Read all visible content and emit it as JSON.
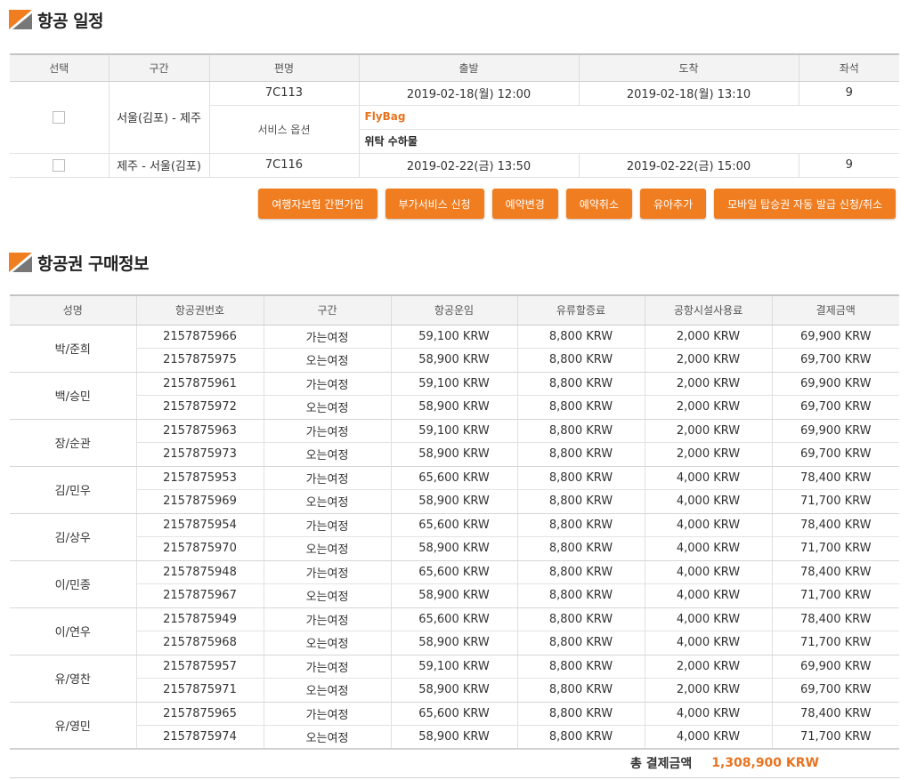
{
  "schedule": {
    "title": "항공 일정",
    "headers": [
      "선택",
      "구간",
      "편명",
      "출발",
      "도착",
      "좌석"
    ],
    "flights": [
      {
        "route": "서울(김포) - 제주",
        "flight": "7C113",
        "depart": "2019-02-18(월) 12:00",
        "arrive": "2019-02-18(월) 13:10",
        "seats": "9",
        "service_label": "서비스 옵션",
        "service_name": "FlyBag",
        "service_desc": "위탁 수하물"
      },
      {
        "route": "제주 - 서울(김포)",
        "flight": "7C116",
        "depart": "2019-02-22(금) 13:50",
        "arrive": "2019-02-22(금) 15:00",
        "seats": "9"
      }
    ]
  },
  "actions": {
    "insurance": "여행자보험 간편가입",
    "extra_service": "부가서비스 신청",
    "change": "예약변경",
    "cancel": "예약취소",
    "add_infant": "유아추가",
    "mobile_pass": "모바일 탑승권 자동 발급 신청/취소"
  },
  "purchase": {
    "title": "항공권 구매정보",
    "headers": [
      "성명",
      "항공권번호",
      "구간",
      "항공운임",
      "유류할증료",
      "공항시설사용료",
      "결제금액"
    ],
    "passengers": [
      {
        "name": "박/준희",
        "tickets": [
          {
            "no": "2157875966",
            "leg": "가는여정",
            "fare": "59,100 KRW",
            "fuel": "8,800 KRW",
            "airport": "2,000 KRW",
            "total": "69,900 KRW"
          },
          {
            "no": "2157875975",
            "leg": "오는여정",
            "fare": "58,900 KRW",
            "fuel": "8,800 KRW",
            "airport": "2,000 KRW",
            "total": "69,700 KRW"
          }
        ]
      },
      {
        "name": "백/승민",
        "tickets": [
          {
            "no": "2157875961",
            "leg": "가는여정",
            "fare": "59,100 KRW",
            "fuel": "8,800 KRW",
            "airport": "2,000 KRW",
            "total": "69,900 KRW"
          },
          {
            "no": "2157875972",
            "leg": "오는여정",
            "fare": "58,900 KRW",
            "fuel": "8,800 KRW",
            "airport": "2,000 KRW",
            "total": "69,700 KRW"
          }
        ]
      },
      {
        "name": "장/순관",
        "tickets": [
          {
            "no": "2157875963",
            "leg": "가는여정",
            "fare": "59,100 KRW",
            "fuel": "8,800 KRW",
            "airport": "2,000 KRW",
            "total": "69,900 KRW"
          },
          {
            "no": "2157875973",
            "leg": "오는여정",
            "fare": "58,900 KRW",
            "fuel": "8,800 KRW",
            "airport": "2,000 KRW",
            "total": "69,700 KRW"
          }
        ]
      },
      {
        "name": "김/민우",
        "tickets": [
          {
            "no": "2157875953",
            "leg": "가는여정",
            "fare": "65,600 KRW",
            "fuel": "8,800 KRW",
            "airport": "4,000 KRW",
            "total": "78,400 KRW"
          },
          {
            "no": "2157875969",
            "leg": "오는여정",
            "fare": "58,900 KRW",
            "fuel": "8,800 KRW",
            "airport": "4,000 KRW",
            "total": "71,700 KRW"
          }
        ]
      },
      {
        "name": "김/상우",
        "tickets": [
          {
            "no": "2157875954",
            "leg": "가는여정",
            "fare": "65,600 KRW",
            "fuel": "8,800 KRW",
            "airport": "4,000 KRW",
            "total": "78,400 KRW"
          },
          {
            "no": "2157875970",
            "leg": "오는여정",
            "fare": "58,900 KRW",
            "fuel": "8,800 KRW",
            "airport": "4,000 KRW",
            "total": "71,700 KRW"
          }
        ]
      },
      {
        "name": "이/민종",
        "tickets": [
          {
            "no": "2157875948",
            "leg": "가는여정",
            "fare": "65,600 KRW",
            "fuel": "8,800 KRW",
            "airport": "4,000 KRW",
            "total": "78,400 KRW"
          },
          {
            "no": "2157875967",
            "leg": "오는여정",
            "fare": "58,900 KRW",
            "fuel": "8,800 KRW",
            "airport": "4,000 KRW",
            "total": "71,700 KRW"
          }
        ]
      },
      {
        "name": "이/연우",
        "tickets": [
          {
            "no": "2157875949",
            "leg": "가는여정",
            "fare": "65,600 KRW",
            "fuel": "8,800 KRW",
            "airport": "4,000 KRW",
            "total": "78,400 KRW"
          },
          {
            "no": "2157875968",
            "leg": "오는여정",
            "fare": "58,900 KRW",
            "fuel": "8,800 KRW",
            "airport": "4,000 KRW",
            "total": "71,700 KRW"
          }
        ]
      },
      {
        "name": "유/영찬",
        "tickets": [
          {
            "no": "2157875957",
            "leg": "가는여정",
            "fare": "59,100 KRW",
            "fuel": "8,800 KRW",
            "airport": "2,000 KRW",
            "total": "69,900 KRW"
          },
          {
            "no": "2157875971",
            "leg": "오는여정",
            "fare": "58,900 KRW",
            "fuel": "8,800 KRW",
            "airport": "2,000 KRW",
            "total": "69,700 KRW"
          }
        ]
      },
      {
        "name": "유/영민",
        "tickets": [
          {
            "no": "2157875965",
            "leg": "가는여정",
            "fare": "65,600 KRW",
            "fuel": "8,800 KRW",
            "airport": "4,000 KRW",
            "total": "78,400 KRW"
          },
          {
            "no": "2157875974",
            "leg": "오는여정",
            "fare": "58,900 KRW",
            "fuel": "8,800 KRW",
            "airport": "4,000 KRW",
            "total": "71,700 KRW"
          }
        ]
      }
    ],
    "total_label": "총 결제금액",
    "total_amount": "1,308,900 KRW"
  },
  "colors": {
    "accent": "#f07d20",
    "accent_text": "#e8731f",
    "header_bg": "#f3f3f3"
  }
}
